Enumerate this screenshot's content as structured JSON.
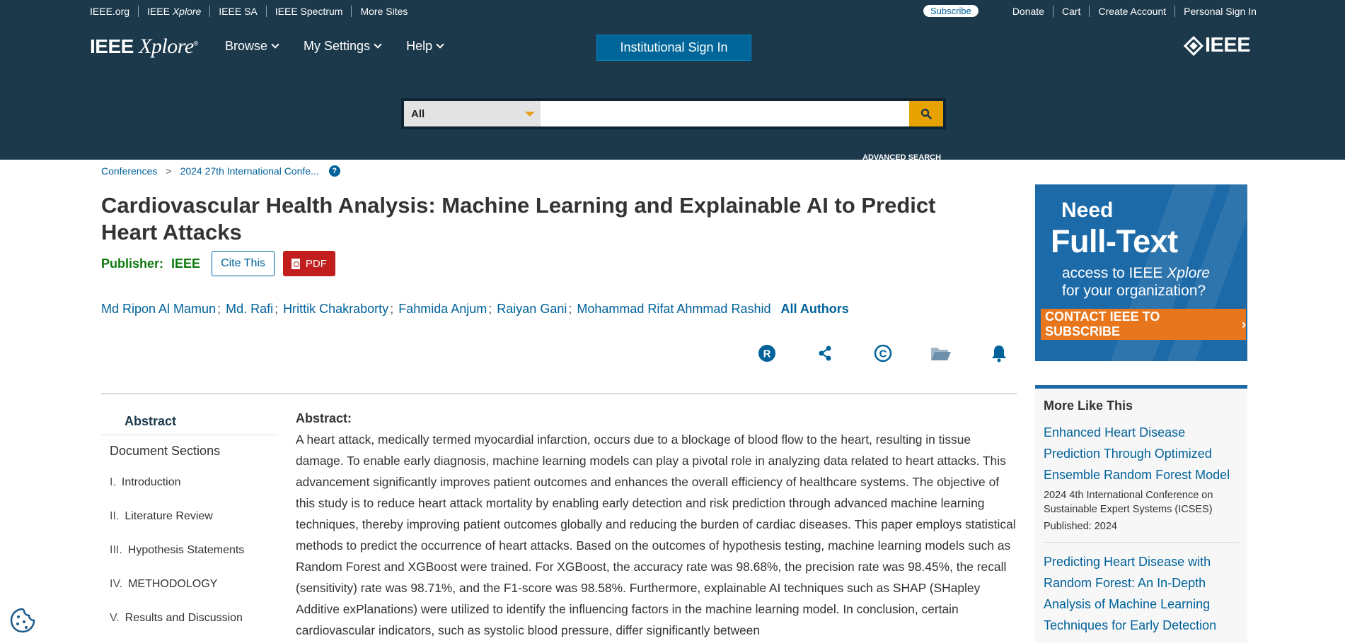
{
  "utility_bar": {
    "links": [
      "IEEE.org",
      "IEEE Xplore",
      "IEEE SA",
      "IEEE Spectrum",
      "More Sites"
    ],
    "subscribe": "Subscribe",
    "right_links": [
      "Donate",
      "Cart",
      "Create Account",
      "Personal Sign In"
    ]
  },
  "header": {
    "logo_ieee": "IEEE",
    "logo_xplore": "Xplore",
    "logo_reg": "®",
    "nav": [
      "Browse",
      "My Settings",
      "Help"
    ],
    "institutional_sign_in": "Institutional Sign In",
    "ieee_brand": "IEEE"
  },
  "search": {
    "scope": "All",
    "query": "",
    "advanced": "ADVANCED SEARCH",
    "icon": "search-icon"
  },
  "breadcrumb": [
    "Conferences",
    "2024 27th International Confe..."
  ],
  "document": {
    "title": "Cardiovascular Health Analysis: Machine Learning and Explainable AI to Predict Heart Attacks",
    "publisher_label": "Publisher:",
    "publisher_name": "IEEE",
    "cite_label": "Cite This",
    "pdf_label": "PDF",
    "authors": [
      "Md Ripon Al Mamun",
      "Md. Rafi",
      "Hrittik Chakraborty",
      "Fahmida Anjum",
      "Raiyan Gani",
      "Mohammad Rifat Ahmmad Rashid"
    ],
    "all_authors": "All Authors",
    "tools": [
      "rights-r-icon",
      "share-icon",
      "copyright-icon",
      "folder-icon",
      "bell-icon"
    ]
  },
  "doc_nav": {
    "abstract": "Abstract",
    "sections_heading": "Document Sections",
    "sections": [
      {
        "num": "I.",
        "label": "Introduction"
      },
      {
        "num": "II.",
        "label": "Literature Review"
      },
      {
        "num": "III.",
        "label": "Hypothesis Statements"
      },
      {
        "num": "IV.",
        "label": "METHODOLOGY"
      },
      {
        "num": "V.",
        "label": "Results and Discussion"
      }
    ]
  },
  "abstract": {
    "label": "Abstract:",
    "text": "A heart attack, medically termed myocardial infarction, occurs due to a blockage of blood flow to the heart, resulting in tissue damage. To enable early diagnosis, machine learning models can play a pivotal role in analyzing data related to heart attacks. This advancement significantly improves patient outcomes and enhances the overall efficiency of healthcare systems. The objective of this study is to reduce heart attack mortality by enabling early detection and risk prediction through advanced machine learning techniques, thereby improving patient outcomes globally and reducing the burden of cardiac diseases. This paper employs statistical methods to predict the occurrence of heart attacks. Based on the outcomes of hypothesis testing, machine learning models such as Random Forest and XGBoost were trained. For XGBoost, the accuracy rate was 98.68%, the precision rate was 98.45%, the recall (sensitivity) rate was 98.71%, and the F1-score was 98.58%. Furthermore, explainable AI techniques such as SHAP (SHapley Additive exPlanations) were utilized to identify the influencing factors in the machine learning model. In conclusion, certain cardiovascular indicators, such as systolic blood pressure, differ significantly between"
  },
  "ad": {
    "need": "Need",
    "full_text": "Full-Text",
    "access_line1_pre": "access to IEEE ",
    "access_line1_em": "Xplore",
    "access_line2": "for your organization?",
    "cta": "CONTACT IEEE TO SUBSCRIBE"
  },
  "more_like_this": {
    "title": "More Like This",
    "items": [
      {
        "title": "Enhanced Heart Disease Prediction Through Optimized Ensemble Random Forest Model",
        "venue": "2024 4th International Conference on Sustainable Expert Systems (ICSES)",
        "published": "Published: 2024"
      },
      {
        "title": "Predicting Heart Disease with Random Forest: An In-Depth Analysis of Machine Learning Techniques for Early Detection",
        "venue": "",
        "published": ""
      }
    ]
  },
  "colors": {
    "header_bg": "#1c394b",
    "link": "#00629b",
    "publisher_green": "#0b7a0b",
    "pdf_red": "#c21e1e",
    "search_btn": "#e8a200",
    "ad_blue": "#1d6aa8",
    "cta_orange": "#e8761c"
  }
}
